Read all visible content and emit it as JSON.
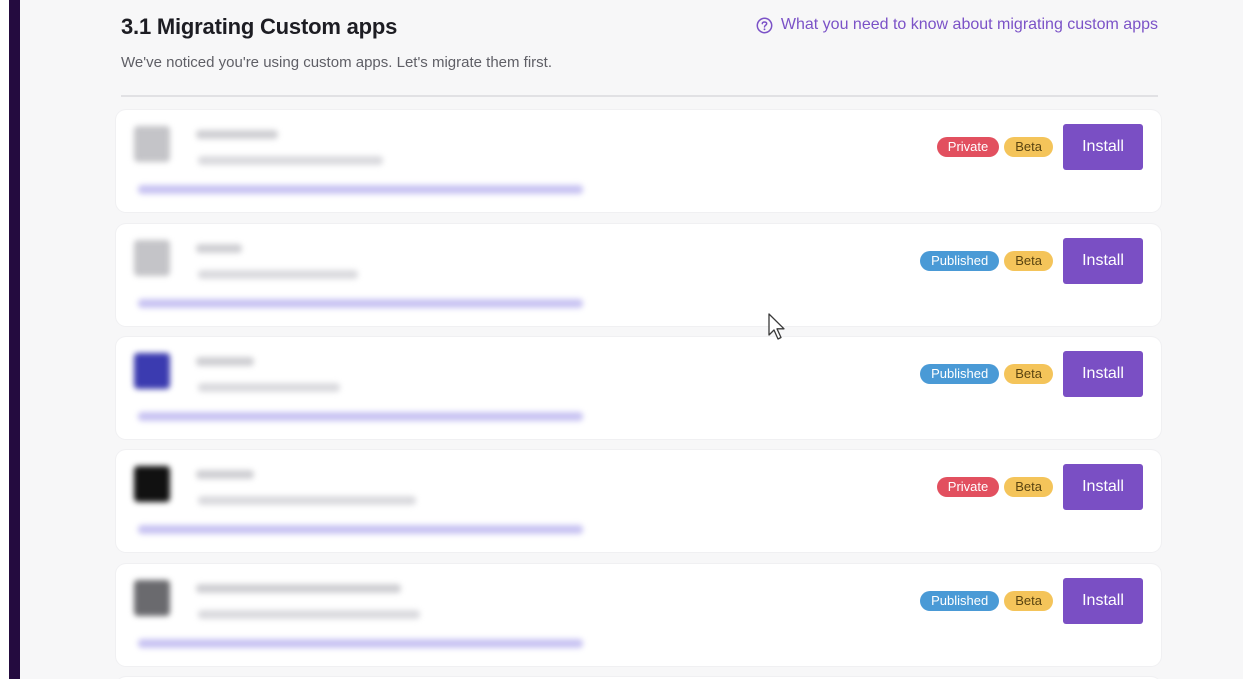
{
  "section": {
    "title": "3.1 Migrating Custom apps",
    "subtitle": "We've noticed you're using custom apps. Let's migrate them first.",
    "help_link": "What you need to know about migrating custom apps"
  },
  "colors": {
    "accent": "#7a4fc4",
    "private_badge": "#e2505f",
    "published_badge": "#4a9ad6",
    "beta_badge": "#f4c45a",
    "rail": "#240b3f"
  },
  "apps": [
    {
      "status": "Private",
      "channel": "Beta",
      "action": "Install",
      "logo_color": "#c4c4c8"
    },
    {
      "status": "Published",
      "channel": "Beta",
      "action": "Install",
      "logo_color": "#c4c4c8"
    },
    {
      "status": "Published",
      "channel": "Beta",
      "action": "Install",
      "logo_color": "#3b3bb0"
    },
    {
      "status": "Private",
      "channel": "Beta",
      "action": "Install",
      "logo_color": "#111111"
    },
    {
      "status": "Published",
      "channel": "Beta",
      "action": "Install",
      "logo_color": "#6a6a6e"
    }
  ]
}
